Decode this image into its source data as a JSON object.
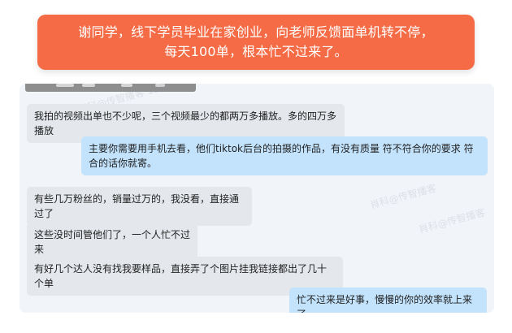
{
  "banner": {
    "line1": "谢同学，线下学员毕业在家创业，向老师反馈面单机转不停，",
    "line2": "每天100单，根本忙不过来了。"
  },
  "chat": {
    "messages": [
      {
        "side": "left",
        "text": "我拍的视频出单也不少呢，三个视频最少的都两万多播放。多的四万多播放"
      },
      {
        "side": "right",
        "text": "主要你需要用手机去看，他们tiktok后台的拍摄的作品，有没有质量 符不符合你的要求 符合的话你就寄。"
      },
      {
        "side": "left",
        "text": "有些几万粉丝的，销量过万的，我没看，直接通过了"
      },
      {
        "side": "left",
        "text": "这些没时间管他们了，一个人忙不过来"
      },
      {
        "side": "left",
        "text": "有好几个达人没有找我要样品，直接弄了个图片挂我链接都出了几十个单"
      },
      {
        "side": "right",
        "text": "忙不过来是好事，慢慢的你的效率就上来了。"
      }
    ]
  },
  "watermarks": [
    "肖科@传智播客 1384",
    "肖科@传智播客 1384",
    "肖科@传智播客",
    "肖科@传智播客",
    "肖科@传智播客"
  ],
  "colors": {
    "banner_bg": "#f46b45",
    "chat_bg": "#f1f4f8",
    "left_bubble": "#e4e7ec",
    "right_bubble": "#c3e3fd"
  }
}
